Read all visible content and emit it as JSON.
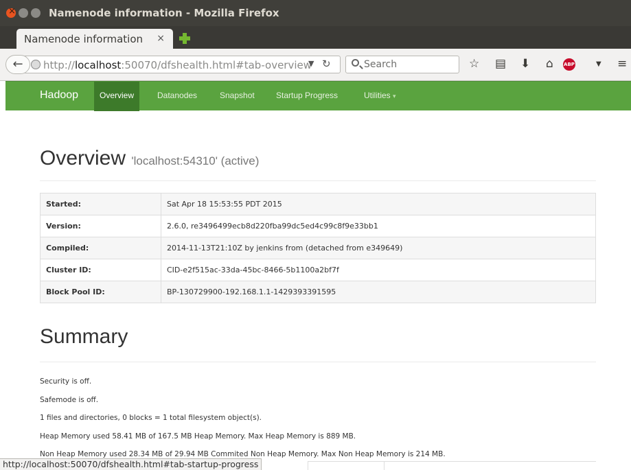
{
  "window": {
    "title": "Namenode information - Mozilla Firefox"
  },
  "tab": {
    "title": "Namenode information",
    "close_glyph": "×"
  },
  "navbar": {
    "url_prefix": "http://",
    "url_host": "localhost",
    "url_rest": ":50070/dfshealth.html#tab-overview",
    "search_placeholder": "Search"
  },
  "hadoop_nav": {
    "brand": "Hadoop",
    "items": [
      "Overview",
      "Datanodes",
      "Snapshot",
      "Startup Progress",
      "Utilities"
    ],
    "dropdown_caret": "▾",
    "active_index": 0
  },
  "overview": {
    "title": "Overview",
    "subtitle": "'localhost:54310' (active)",
    "rows": [
      {
        "key": "Started:",
        "value": "Sat Apr 18 15:53:55 PDT 2015"
      },
      {
        "key": "Version:",
        "value": "2.6.0, re3496499ecb8d220fba99dc5ed4c99c8f9e33bb1"
      },
      {
        "key": "Compiled:",
        "value": "2014-11-13T21:10Z by jenkins from (detached from e349649)"
      },
      {
        "key": "Cluster ID:",
        "value": "CID-e2f515ac-33da-45bc-8466-5b1100a2bf7f"
      },
      {
        "key": "Block Pool ID:",
        "value": "BP-130729900-192.168.1.1-1429393391595"
      }
    ]
  },
  "summary": {
    "title": "Summary",
    "lines": [
      "Security is off.",
      "Safemode is off.",
      "1 files and directories, 0 blocks = 1 total filesystem object(s).",
      "Heap Memory used 58.41 MB of 167.5 MB Heap Memory. Max Heap Memory is 889 MB.",
      "Non Heap Memory used 28.34 MB of 29.94 MB Commited Non Heap Memory. Max Non Heap Memory is 214 MB."
    ]
  },
  "status": {
    "link": "http://localhost:50070/dfshealth.html#tab-startup-progress"
  },
  "icons": {
    "back": "back-arrow-icon",
    "globe": "globe-icon",
    "reload": "reload-icon",
    "search": "search-icon",
    "bookmark": "star-icon",
    "reading_list": "clipboard-icon",
    "downloads": "download-arrow-icon",
    "home": "home-icon",
    "adblock": "adblock-icon",
    "menu": "hamburger-menu-icon"
  },
  "colors": {
    "hadoop_green": "#5aa33f",
    "hadoop_active": "#3d7a2a",
    "titlebar": "#403f3a",
    "close_button": "#e95420"
  }
}
